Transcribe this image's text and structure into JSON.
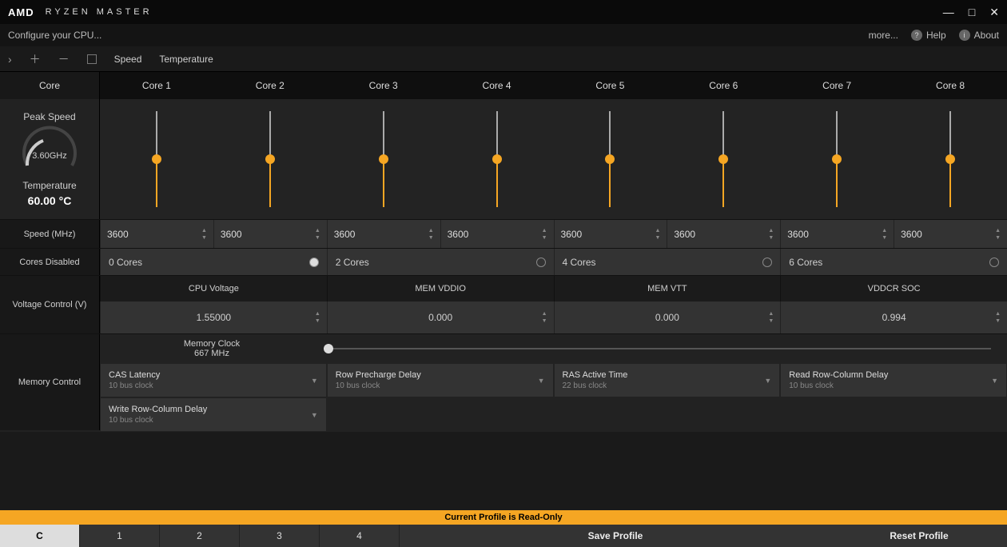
{
  "brand": "AMD",
  "app_title": "RYZEN MASTER",
  "win": {
    "min": "—",
    "max": "□",
    "close": "✕"
  },
  "subbar": {
    "configure": "Configure your CPU...",
    "more": "more...",
    "help": "Help",
    "about": "About"
  },
  "toolbar": {
    "speed": "Speed",
    "temperature": "Temperature"
  },
  "header": {
    "core_label": "Core",
    "cores": [
      "Core 1",
      "Core 2",
      "Core 3",
      "Core 4",
      "Core 5",
      "Core 6",
      "Core 7",
      "Core 8"
    ]
  },
  "peak": {
    "label": "Peak Speed",
    "value": "3.60GHz",
    "temp_label": "Temperature",
    "temp_value": "60.00 °C"
  },
  "speed_row": {
    "label": "Speed (MHz)",
    "values": [
      "3600",
      "3600",
      "3600",
      "3600",
      "3600",
      "3600",
      "3600",
      "3600"
    ]
  },
  "cores_disabled": {
    "label": "Cores Disabled",
    "options": [
      "0 Cores",
      "2 Cores",
      "4 Cores",
      "6 Cores"
    ],
    "selected": "0 Cores"
  },
  "voltage": {
    "label": "Voltage Control (V)",
    "cols": [
      "CPU Voltage",
      "MEM VDDIO",
      "MEM VTT",
      "VDDCR SOC"
    ],
    "vals": [
      "1.55000",
      "0.000",
      "0.000",
      "0.994"
    ]
  },
  "memory": {
    "label": "Memory Control",
    "clock_label": "Memory Clock",
    "clock_value": "667 MHz",
    "params": [
      {
        "label": "CAS Latency",
        "sub": "10 bus clock"
      },
      {
        "label": "Row Precharge Delay",
        "sub": "10 bus clock"
      },
      {
        "label": "RAS Active Time",
        "sub": "22 bus clock"
      },
      {
        "label": "Read Row-Column Delay",
        "sub": "10 bus clock"
      },
      {
        "label": "Write Row-Column Delay",
        "sub": "10 bus clock"
      }
    ]
  },
  "warn": "Current Profile is Read-Only",
  "bottom": {
    "tabs": [
      "C",
      "1",
      "2",
      "3",
      "4"
    ],
    "active": "C",
    "save": "Save Profile",
    "reset": "Reset Profile"
  }
}
